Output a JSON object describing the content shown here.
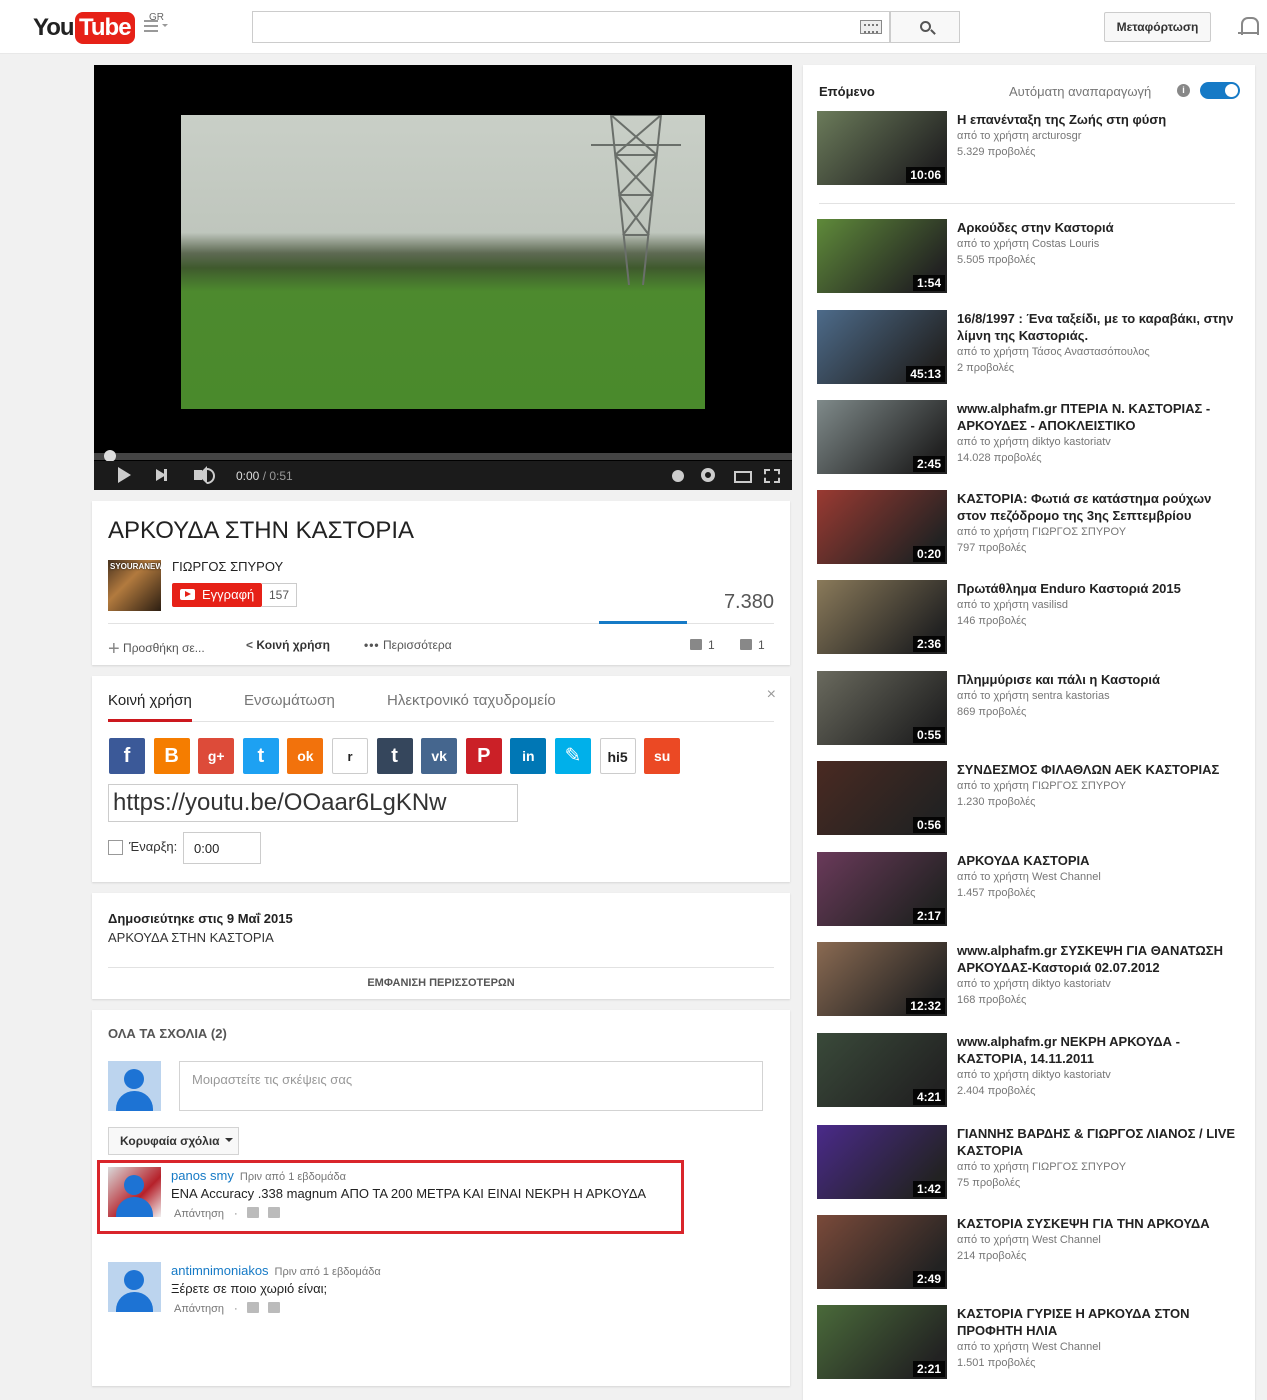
{
  "header": {
    "logo_you": "You",
    "logo_tube": "Tube",
    "region": "GR",
    "search_placeholder": "",
    "upload_label": "Μεταφόρτωση"
  },
  "player": {
    "time_current": "0:00",
    "time_total": " / 0:51",
    "progress_fraction": 0.0
  },
  "video": {
    "title": "ΑΡΚΟΥΔΑ ΣΤΗΝ ΚΑΣΤΟΡΙΑ",
    "channel_name": "ΓΙΩΡΓΟΣ ΣΠΥΡΟΥ",
    "channel_avatar_text": "SYOURANEWS",
    "subscribe_label": "Εγγραφή",
    "subscriber_count": "157",
    "view_count": "7.380",
    "add_to_label": "Προσθήκη σε...",
    "share_label": "Κοινή χρήση",
    "more_label": "Περισσότερα",
    "likes": "1",
    "dislikes": "1"
  },
  "share_panel": {
    "tabs": [
      "Κοινή χρήση",
      "Ενσωμάτωση",
      "Ηλεκτρονικό ταχυδρομείο"
    ],
    "close": "×",
    "networks": [
      {
        "icon": "facebook-icon",
        "glyph": "f",
        "color": "#3b5998"
      },
      {
        "icon": "blogger-icon",
        "glyph": "B",
        "color": "#f57d00"
      },
      {
        "icon": "google-plus-icon",
        "glyph": "g+",
        "color": "#dd4b39"
      },
      {
        "icon": "twitter-icon",
        "glyph": "t",
        "color": "#1da1f2"
      },
      {
        "icon": "odnoklassniki-icon",
        "glyph": "ok",
        "color": "#f2720c"
      },
      {
        "icon": "reddit-icon",
        "glyph": "r",
        "color": "#ffffff"
      },
      {
        "icon": "tumblr-icon",
        "glyph": "t",
        "color": "#35465c"
      },
      {
        "icon": "vk-icon",
        "glyph": "vk",
        "color": "#45668e"
      },
      {
        "icon": "pinterest-icon",
        "glyph": "P",
        "color": "#cb2027"
      },
      {
        "icon": "linkedin-icon",
        "glyph": "in",
        "color": "#0077b5"
      },
      {
        "icon": "livejournal-icon",
        "glyph": "✎",
        "color": "#00b0ea"
      },
      {
        "icon": "hi5-icon",
        "glyph": "hi5",
        "color": "#ffffff"
      },
      {
        "icon": "stumbleupon-icon",
        "glyph": "su",
        "color": "#eb4924"
      }
    ],
    "url": "https://youtu.be/OOaar6LgKNw",
    "start_label": "Έναρξη:",
    "start_value": "0:00"
  },
  "description": {
    "published": "Δημοσιεύτηκε στις 9 Μαΐ 2015",
    "text": "ΑΡΚΟΥΔΑ ΣΤΗΝ ΚΑΣΤΟΡΙΑ",
    "show_more": "ΕΜΦΑΝΙΣΗ ΠΕΡΙΣΣΟΤΕΡΩΝ"
  },
  "comments": {
    "title": "ΟΛΑ ΤΑ ΣΧΟΛΙΑ (2)",
    "placeholder": "Μοιραστείτε τις σκέψεις σας",
    "sort_label": "Κορυφαία σχόλια",
    "items": [
      {
        "author": "panos smy",
        "time": "Πριν από 1 εβδομάδα",
        "text": "ΕΝΑ Accuracy .338 magnum ΑΠΟ ΤΑ 200 ΜΕΤΡΑ ΚΑΙ ΕΙΝΑΙ ΝΕΚΡΗ Η ΑΡΚΟΥΔΑ",
        "reply": "Απάντηση",
        "dot": "·"
      },
      {
        "author": "antimnimoniakos",
        "time": "Πριν από 1 εβδομάδα",
        "text": "Ξέρετε σε ποιο χωριό είναι;",
        "reply": "Απάντηση",
        "dot": "·"
      }
    ]
  },
  "sidebar": {
    "next_label": "Επόμενο",
    "autoplay_label": "Αυτόματη αναπαραγωγή",
    "autoplay_on": true,
    "info_glyph": "i",
    "videos": [
      {
        "title": "Η επανένταξη της Ζωής στη φύση",
        "channel": "από το χρήστη arcturosgr",
        "views": "5.329 προβολές",
        "duration": "10:06",
        "color": "#6b7b5a"
      },
      {
        "title": "Αρκούδες στην Καστοριά",
        "channel": "από το χρήστη Costas Louris",
        "views": "5.505 προβολές",
        "duration": "1:54",
        "color": "#5f8a3a"
      },
      {
        "title": "16/8/1997 : Ένα ταξείδι, με το καραβάκι, στην λίμνη της Καστοριάς.",
        "channel": "από το χρήστη Τάσος Αναστασόπουλος",
        "views": "2 προβολές",
        "duration": "45:13",
        "color": "#4d6b8a"
      },
      {
        "title": "www.alphafm.gr ΠΤΕΡΙΑ Ν. ΚΑΣΤΟΡΙΑΣ - ΑΡΚΟΥΔΕΣ - ΑΠΟΚΛΕΙΣΤΙΚΟ",
        "channel": "από το χρήστη diktyo kastoriatv",
        "views": "14.028 προβολές",
        "duration": "2:45",
        "color": "#7f8a8a"
      },
      {
        "title": "ΚΑΣΤΟΡΙΑ: Φωτιά σε κατάστημα ρούχων στον πεζόδρομο της 3ης Σεπτεμβρίου",
        "channel": "από το χρήστη ΓΙΩΡΓΟΣ ΣΠΥΡΟΥ",
        "views": "797 προβολές",
        "duration": "0:20",
        "color": "#9a3a32"
      },
      {
        "title": "Πρωτάθλημα Enduro Καστοριά 2015",
        "channel": "από το χρήστη vasilisd",
        "views": "146 προβολές",
        "duration": "2:36",
        "color": "#8a7a5a"
      },
      {
        "title": "Πλημμύρισε και πάλι η Καστοριά",
        "channel": "από το χρήστη sentra kastorias",
        "views": "869 προβολές",
        "duration": "0:55",
        "color": "#6a6a5e"
      },
      {
        "title": "ΣΥΝΔΕΣΜΟΣ ΦΙΛΑΘΛΩΝ ΑΕΚ ΚΑΣΤΟΡΙΑΣ",
        "channel": "από το χρήστη ΓΙΩΡΓΟΣ ΣΠΥΡΟΥ",
        "views": "1.230 προβολές",
        "duration": "0:56",
        "color": "#4a2a22"
      },
      {
        "title": "ΑΡΚΟΥΔΑ ΚΑΣΤΟΡΙΑ",
        "channel": "από το χρήστη West Channel",
        "views": "1.457 προβολές",
        "duration": "2:17",
        "color": "#6a3a5a"
      },
      {
        "title": "www.alphafm.gr ΣΥΣΚΕΨΗ ΓΙΑ ΘΑΝΑΤΩΣΗ ΑΡΚΟΥΔΑΣ-Καστοριά 02.07.2012",
        "channel": "από το χρήστη diktyo kastoriatv",
        "views": "168 προβολές",
        "duration": "12:32",
        "color": "#8a6a52"
      },
      {
        "title": "www.alphafm.gr ΝΕΚΡΗ ΑΡΚΟΥΔΑ - ΚΑΣΤΟΡΙΑ, 14.11.2011",
        "channel": "από το χρήστη diktyo kastoriatv",
        "views": "2.404 προβολές",
        "duration": "4:21",
        "color": "#3a4a3a"
      },
      {
        "title": "ΓΙΑΝΝΗΣ ΒΑΡΔΗΣ & ΓΙΩΡΓΟΣ ΛΙΑΝΟΣ / LIVE ΚΑΣΤΟΡΙΑ",
        "channel": "από το χρήστη ΓΙΩΡΓΟΣ ΣΠΥΡΟΥ",
        "views": "75 προβολές",
        "duration": "1:42",
        "color": "#4a2a8a"
      },
      {
        "title": "ΚΑΣΤΟΡΙΑ ΣΥΣΚΕΨΗ ΓΙΑ ΤΗΝ ΑΡΚΟΥΔΑ",
        "channel": "από το χρήστη West Channel",
        "views": "214 προβολές",
        "duration": "2:49",
        "color": "#7a4a3a"
      },
      {
        "title": "ΚΑΣΤΟΡΙΑ ΓΥΡΙΣΕ Η ΑΡΚΟΥΔΑ ΣΤΟΝ ΠΡΟΦΗΤΗ ΗΛΙΑ",
        "channel": "από το χρήστη West Channel",
        "views": "1.501 προβολές",
        "duration": "2:21",
        "color": "#4a6a3a"
      }
    ]
  }
}
